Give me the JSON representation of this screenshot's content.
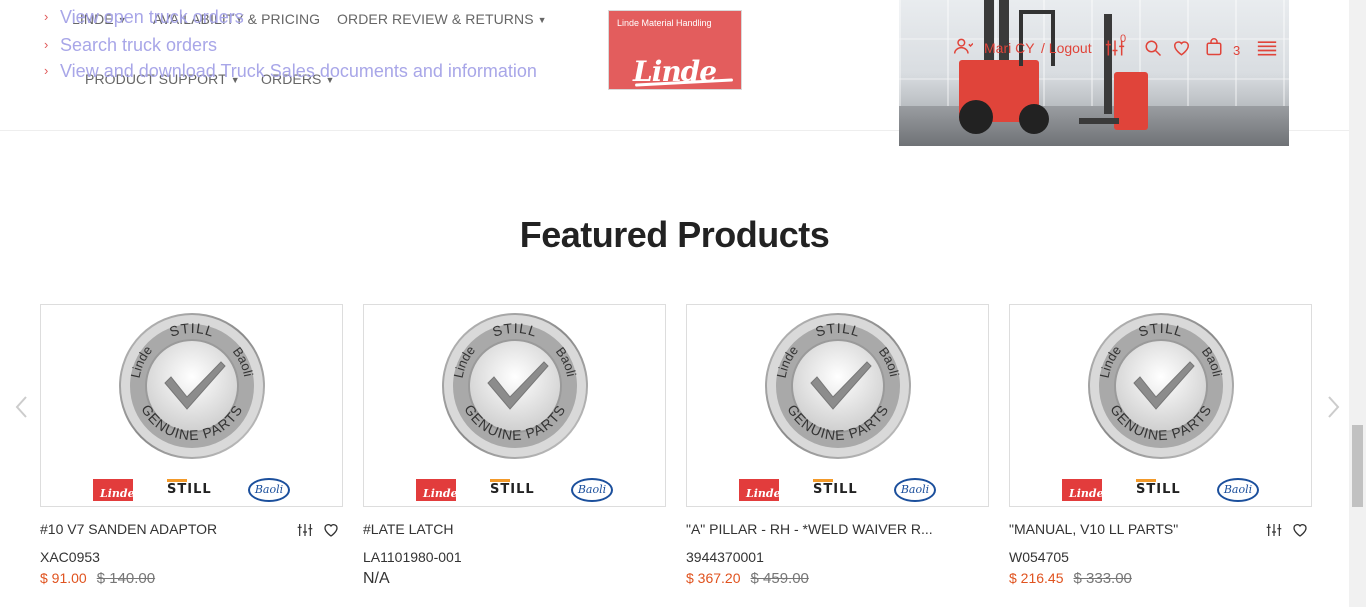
{
  "nav": {
    "linde": "LINDE",
    "availability": "AVAILABILITY & PRICING",
    "order_review": "ORDER REVIEW & RETURNS",
    "product_support": "PRODUCT SUPPORT",
    "orders": "ORDERS"
  },
  "dropdown_links": [
    "View open truck orders",
    "Search truck orders",
    "View and download Truck Sales documents and information"
  ],
  "logo": {
    "small": "Linde Material Handling",
    "brand": "Linde"
  },
  "user": {
    "name": "Mari CY",
    "logout": "/ Logout",
    "compare_count": "0",
    "cart_count": "3"
  },
  "section_title": "Featured Products",
  "badge": {
    "top": "STILL",
    "left": "Linde",
    "right": "Baoli",
    "bottom": "GENUINE PARTS",
    "brands": {
      "linde": "Linde",
      "still": "STILL",
      "baoli": "Baoli"
    }
  },
  "products": [
    {
      "name": "#10 V7 SANDEN ADAPTOR",
      "sku": "XAC0953",
      "price": "$ 91.00",
      "old_price": "$ 140.00",
      "show_actions": true
    },
    {
      "name": "#LATE LATCH",
      "sku": "LA1101980-001",
      "price": "N/A",
      "old_price": "",
      "show_actions": false
    },
    {
      "name": "\"A\" PILLAR - RH - *WELD WAIVER R...",
      "sku": "3944370001",
      "price": "$ 367.20",
      "old_price": "$ 459.00",
      "show_actions": false
    },
    {
      "name": "\"MANUAL, V10 LL PARTS\"",
      "sku": "W054705",
      "price": "$ 216.45",
      "old_price": "$ 333.00",
      "show_actions": true
    }
  ],
  "colors": {
    "accent": "#e0443a",
    "price": "#e0531f",
    "link": "#a8a6e8"
  },
  "icons": [
    "user-icon",
    "compare-icon",
    "search-icon",
    "heart-icon",
    "cart-icon",
    "menu-icon",
    "chevron-left-icon",
    "chevron-right-icon"
  ]
}
